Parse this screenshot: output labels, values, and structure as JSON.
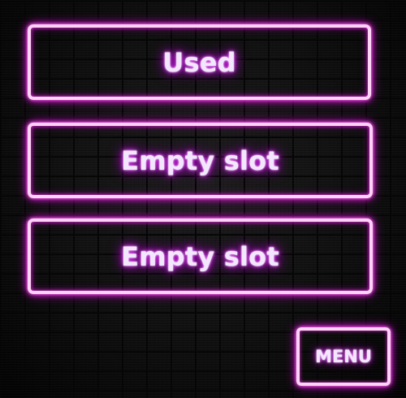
{
  "slots": [
    {
      "label": "Used"
    },
    {
      "label": "Empty slot"
    },
    {
      "label": "Empty slot"
    }
  ],
  "menu": {
    "label": "MENU"
  },
  "colors": {
    "neon_border": "#ffd3f6",
    "neon_glow": "#e12cd9",
    "text": "#f3e7ff",
    "background": "#111111"
  }
}
